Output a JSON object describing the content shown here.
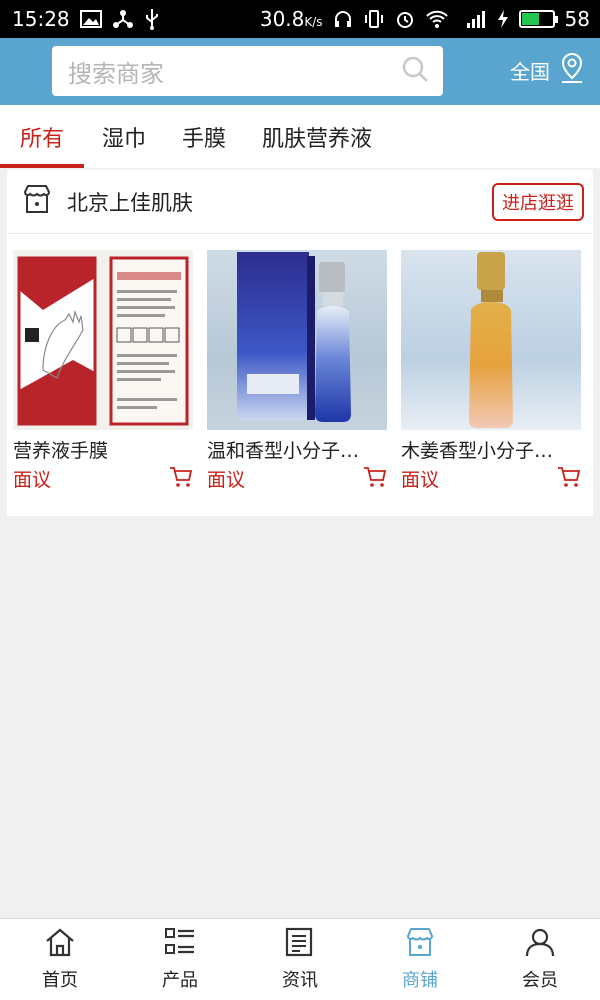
{
  "status_bar": {
    "time": "15:28",
    "speed": "30.8",
    "speed_unit": "K/s",
    "network": "4G",
    "battery": "58",
    "battery_level_percent": 58,
    "battery_color": "#23c552"
  },
  "header": {
    "search_placeholder": "搜索商家",
    "region_label": "全国",
    "bg_color": "#5aa5cf"
  },
  "tabs": [
    {
      "label": "所有",
      "active": true
    },
    {
      "label": "湿巾",
      "active": false
    },
    {
      "label": "手膜",
      "active": false
    },
    {
      "label": "肌肤营养液",
      "active": false
    }
  ],
  "shop": {
    "name": "北京上佳肌肤",
    "visit_label": "进店逛逛",
    "accent_color": "#c9221b",
    "products": [
      {
        "name": "营养液手膜",
        "price": "面议",
        "image_icon": "hand-mask-package"
      },
      {
        "name": "温和香型小分子肌...",
        "price": "面议",
        "image_icon": "blue-serum-bottle"
      },
      {
        "name": "木姜香型小分子肌...",
        "price": "面议",
        "image_icon": "amber-serum-bottle"
      }
    ]
  },
  "bottom_nav": [
    {
      "label": "首页",
      "icon": "home-icon",
      "active": false
    },
    {
      "label": "产品",
      "icon": "list-icon",
      "active": false
    },
    {
      "label": "资讯",
      "icon": "news-icon",
      "active": false
    },
    {
      "label": "商铺",
      "icon": "store-icon",
      "active": true
    },
    {
      "label": "会员",
      "icon": "user-icon",
      "active": false
    }
  ]
}
